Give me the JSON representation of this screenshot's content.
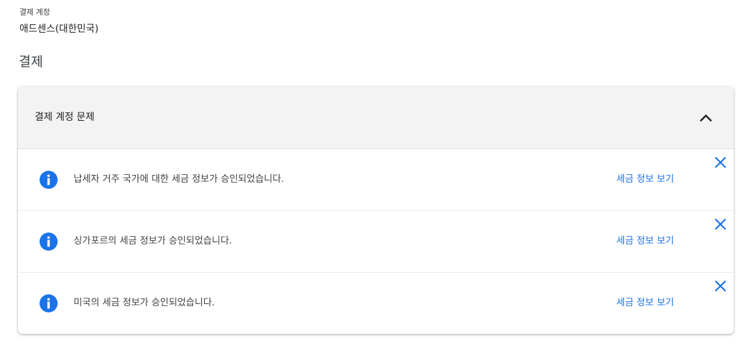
{
  "account": {
    "caption": "결제 계정",
    "name": "애드센스(대한민국)"
  },
  "section_title": "결제",
  "card": {
    "header_title": "결제 계정 문제",
    "toggle_icon": "chevron-up-icon",
    "issues": [
      {
        "icon": "info-icon",
        "message": "납세자 거주 국가에 대한 세금 정보가 승인되었습니다.",
        "link_label": "세금 정보 보기",
        "dismiss_icon": "close-icon"
      },
      {
        "icon": "info-icon",
        "message": "싱가포르의 세금 정보가 승인되었습니다.",
        "link_label": "세금 정보 보기",
        "dismiss_icon": "close-icon"
      },
      {
        "icon": "info-icon",
        "message": "미국의 세금 정보가 승인되었습니다.",
        "link_label": "세금 정보 보기",
        "dismiss_icon": "close-icon"
      }
    ]
  },
  "colors": {
    "accent": "#1a73e8",
    "header_bg": "#f3f3f3",
    "text": "#202124"
  }
}
